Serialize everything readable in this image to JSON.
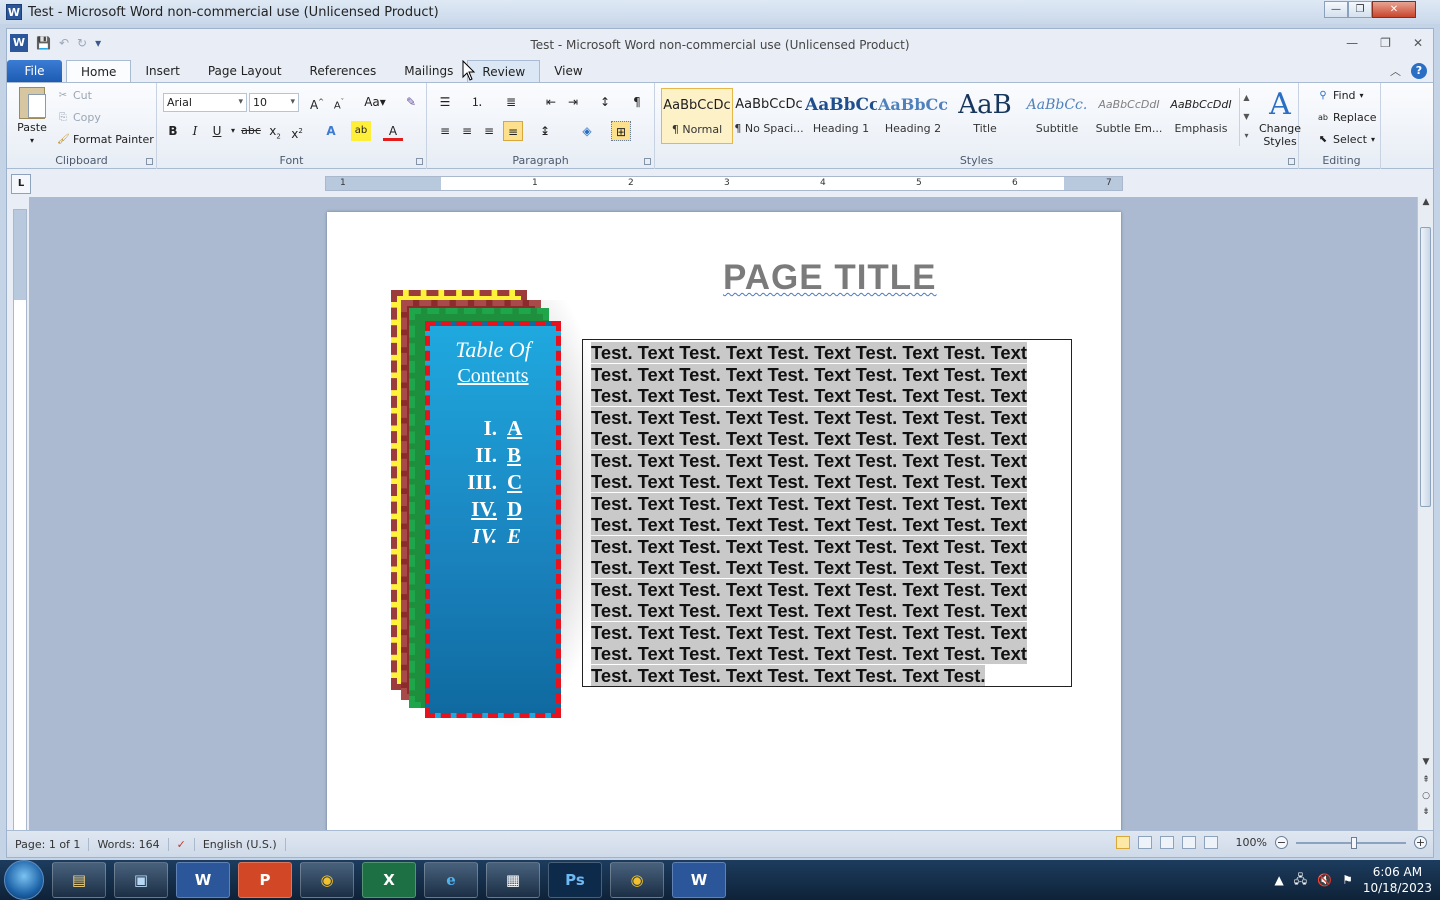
{
  "outer_title": "Test - Microsoft Word non-commercial use (Unlicensed Product)",
  "window_title": "Test  -  Microsoft Word non-commercial use (Unlicensed Product)",
  "tabs": [
    "File",
    "Home",
    "Insert",
    "Page Layout",
    "References",
    "Mailings",
    "Review",
    "View"
  ],
  "active_tab": "Home",
  "clipboard": {
    "paste": "Paste",
    "cut": "Cut",
    "copy": "Copy",
    "format_painter": "Format Painter",
    "label": "Clipboard"
  },
  "font": {
    "name": "Arial",
    "size": "10",
    "label": "Font"
  },
  "paragraph": {
    "label": "Paragraph"
  },
  "styles": {
    "label": "Styles",
    "items": [
      {
        "sample": "AaBbCcDc",
        "name": "¶ Normal"
      },
      {
        "sample": "AaBbCcDc",
        "name": "¶ No Spaci..."
      },
      {
        "sample": "AaBbCc",
        "name": "Heading 1"
      },
      {
        "sample": "AaBbCc",
        "name": "Heading 2"
      },
      {
        "sample": "AaB",
        "name": "Title"
      },
      {
        "sample": "AaBbCc.",
        "name": "Subtitle"
      },
      {
        "sample": "AaBbCcDdI",
        "name": "Subtle Em..."
      },
      {
        "sample": "AaBbCcDdI",
        "name": "Emphasis"
      }
    ],
    "change_styles": "Change Styles"
  },
  "editing": {
    "find": "Find",
    "replace": "Replace",
    "select": "Select",
    "label": "Editing"
  },
  "ruler_numbers": [
    "1",
    "1",
    "2",
    "3",
    "4",
    "5",
    "6",
    "7"
  ],
  "document": {
    "page_title": "PAGE TITLE",
    "toc_title": "Table Of",
    "toc_contents": "Contents",
    "toc_items": [
      {
        "num": "I.",
        "label": "A"
      },
      {
        "num": "II.",
        "label": "B"
      },
      {
        "num": "III.",
        "label": "C"
      },
      {
        "num": "IV.",
        "label": "D"
      },
      {
        "num": "IV.",
        "label": "E"
      }
    ],
    "body_text": "Test. Text Test. Text Test. Text Test. Text Test. Text Test. Text Test. Text Test. Text Test. Text Test. Text Test. Text Test. Text Test. Text Test. Text Test. Text Test. Text Test. Text Test. Text Test. Text Test. Text Test. Text Test. Text Test. Text Test. Text Test. Text Test. Text Test. Text Test. Text Test. Text Test. Text Test. Text Test. Text Test. Text Test. Text Test. Text Test. Text Test. Text Test. Text Test. Text Test. Text Test. Text Test. Text Test. Text Test. Text Test. Text Test. Text Test. Text Test. Text Test. Text Test. Text Test. Text Test. Text Test. Text Test. Text Test. Text Test. Text Test. Text Test. Text Test. Text Test. Text Test. Text Test. Text Test. Text Test. Text Test. Text Test. Text Test. Text Test. Text Test. Text Test. Text Test. Text Test. Text Test. Text Test. Text Test. Text Test. Text Test. Text Test. Text Test. Text Test."
  },
  "status": {
    "page": "Page: 1 of 1",
    "words": "Words: 164",
    "language": "English (U.S.)",
    "zoom": "100%"
  },
  "clock": {
    "time": "6:06 AM",
    "date": "10/18/2023"
  },
  "colors": {
    "toc_border": "#e8121f",
    "toc_fill": "#1fa9df",
    "word_blue": "#2b579a"
  }
}
